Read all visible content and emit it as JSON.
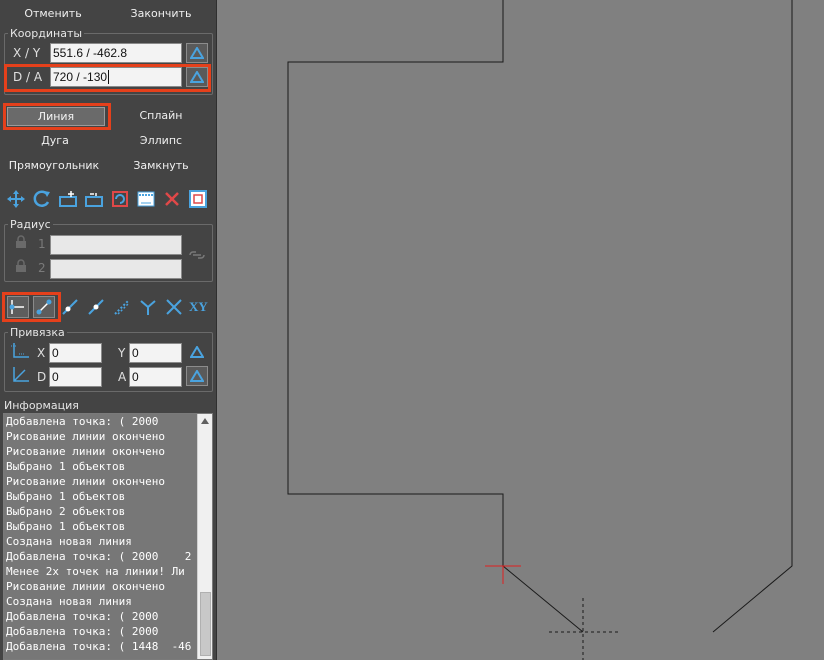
{
  "top_buttons": {
    "cancel": "Отменить",
    "finish": "Закончить"
  },
  "coordinates": {
    "title": "Координаты",
    "xy_label": "X / Y",
    "xy_value": "551.6 / -462.8",
    "da_label": "D / A",
    "da_value": "720 / -130"
  },
  "shapes": {
    "line": "Линия",
    "spline": "Сплайн",
    "arc": "Дуга",
    "ellipse": "Эллипс",
    "rectangle": "Прямоугольник",
    "close": "Замкнуть"
  },
  "tools": [
    {
      "icon": "move-icon"
    },
    {
      "icon": "rotate-icon"
    },
    {
      "icon": "add-point-icon"
    },
    {
      "icon": "remove-point-icon"
    },
    {
      "icon": "transform-icon"
    },
    {
      "icon": "dimension-icon"
    },
    {
      "icon": "delete-icon"
    },
    {
      "icon": "window-icon"
    }
  ],
  "radius": {
    "title": "Радиус",
    "r1_label": "1",
    "r1_value": "",
    "r2_label": "2",
    "r2_value": ""
  },
  "snap_tools": [
    {
      "icon": "segment-start-icon"
    },
    {
      "icon": "segment-end-icon"
    },
    {
      "icon": "snap-line-icon"
    },
    {
      "icon": "snap-mid-icon"
    },
    {
      "icon": "snap-dotted-icon"
    },
    {
      "icon": "snap-perpendicular-icon"
    },
    {
      "icon": "snap-intersection-icon"
    },
    {
      "xy_label": "XY"
    }
  ],
  "binding": {
    "title": "Привязка",
    "x_label": "X",
    "x_value": "0",
    "y_label": "Y",
    "y_value": "0",
    "d_label": "D",
    "d_value": "0",
    "a_label": "A",
    "a_value": "0"
  },
  "info": {
    "title": "Информация",
    "log": [
      "Добавлена точка: ( 2000",
      "Рисование линии окончено",
      "Рисование линии окончено",
      "Выбрано 1 объектов",
      "Рисование линии окончено",
      "Выбрано 1 объектов",
      "Выбрано 2 объектов",
      "Выбрано 1 объектов",
      "Создана новая линия",
      "Добавлена точка: ( 2000    2",
      "Менее 2х точек на линии! Ли",
      "Рисование линии окончено",
      "Создана новая линия",
      "Добавлена точка: ( 2000",
      "Добавлена точка: ( 2000",
      "Добавлена точка: ( 1448  -46"
    ]
  },
  "colors": {
    "panel_bg": "#444444",
    "canvas_bg": "#808080",
    "highlight": "#e5401b",
    "icon_blue": "#4aa3df",
    "icon_red": "#e04848"
  }
}
